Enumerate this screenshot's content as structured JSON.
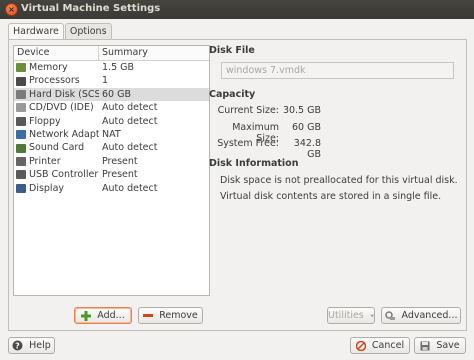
{
  "window": {
    "title": "Virtual Machine Settings",
    "close_glyph": "×"
  },
  "tabs": [
    {
      "label": "Hardware",
      "active": true
    },
    {
      "label": "Options",
      "active": false
    }
  ],
  "device_list": {
    "headers": {
      "device": "Device",
      "summary": "Summary"
    },
    "rows": [
      {
        "device": "Memory",
        "summary": "1.5 GB",
        "icon": "memory-icon",
        "color": "#6a8f3c"
      },
      {
        "device": "Processors",
        "summary": "1",
        "icon": "processor-icon",
        "color": "#4a4a4a"
      },
      {
        "device": "Hard Disk (SCSI)",
        "summary": "60 GB",
        "icon": "hard-disk-icon",
        "color": "#7b7b7b",
        "selected": true
      },
      {
        "device": "CD/DVD (IDE)",
        "summary": "Auto detect",
        "icon": "cd-dvd-icon",
        "color": "#9a9a9a"
      },
      {
        "device": "Floppy",
        "summary": "Auto detect",
        "icon": "floppy-icon",
        "color": "#5a5a5a"
      },
      {
        "device": "Network Adapter",
        "summary": "NAT",
        "icon": "network-adapter-icon",
        "color": "#3b6ea5"
      },
      {
        "device": "Sound Card",
        "summary": "Auto detect",
        "icon": "sound-card-icon",
        "color": "#4f7a3a"
      },
      {
        "device": "Printer",
        "summary": "Present",
        "icon": "printer-icon",
        "color": "#666666"
      },
      {
        "device": "USB Controller",
        "summary": "Present",
        "icon": "usb-controller-icon",
        "color": "#5b5b5b"
      },
      {
        "device": "Display",
        "summary": "Auto detect",
        "icon": "display-icon",
        "color": "#3b5f8a"
      }
    ]
  },
  "list_buttons": {
    "add": "Add...",
    "remove": "Remove"
  },
  "disk_file": {
    "title": "Disk File",
    "value": "windows 7.vmdk"
  },
  "capacity": {
    "title": "Capacity",
    "rows": [
      {
        "label": "Current Size:",
        "value": "30.5 GB"
      },
      {
        "label": "Maximum Size:",
        "value": "60 GB"
      },
      {
        "label": "System Free:",
        "value": "342.8 GB"
      }
    ]
  },
  "disk_info": {
    "title": "Disk Information",
    "lines": [
      "Disk space is not preallocated for this virtual disk.",
      "Virtual disk contents are stored in a single file."
    ]
  },
  "right_buttons": {
    "utilities": "Utilities",
    "advanced": "Advanced..."
  },
  "footer": {
    "help": "Help",
    "cancel": "Cancel",
    "save": "Save"
  },
  "colors": {
    "accent": "#e98253",
    "titlebar": "#3b3a36",
    "close": "#dd4a1a"
  }
}
